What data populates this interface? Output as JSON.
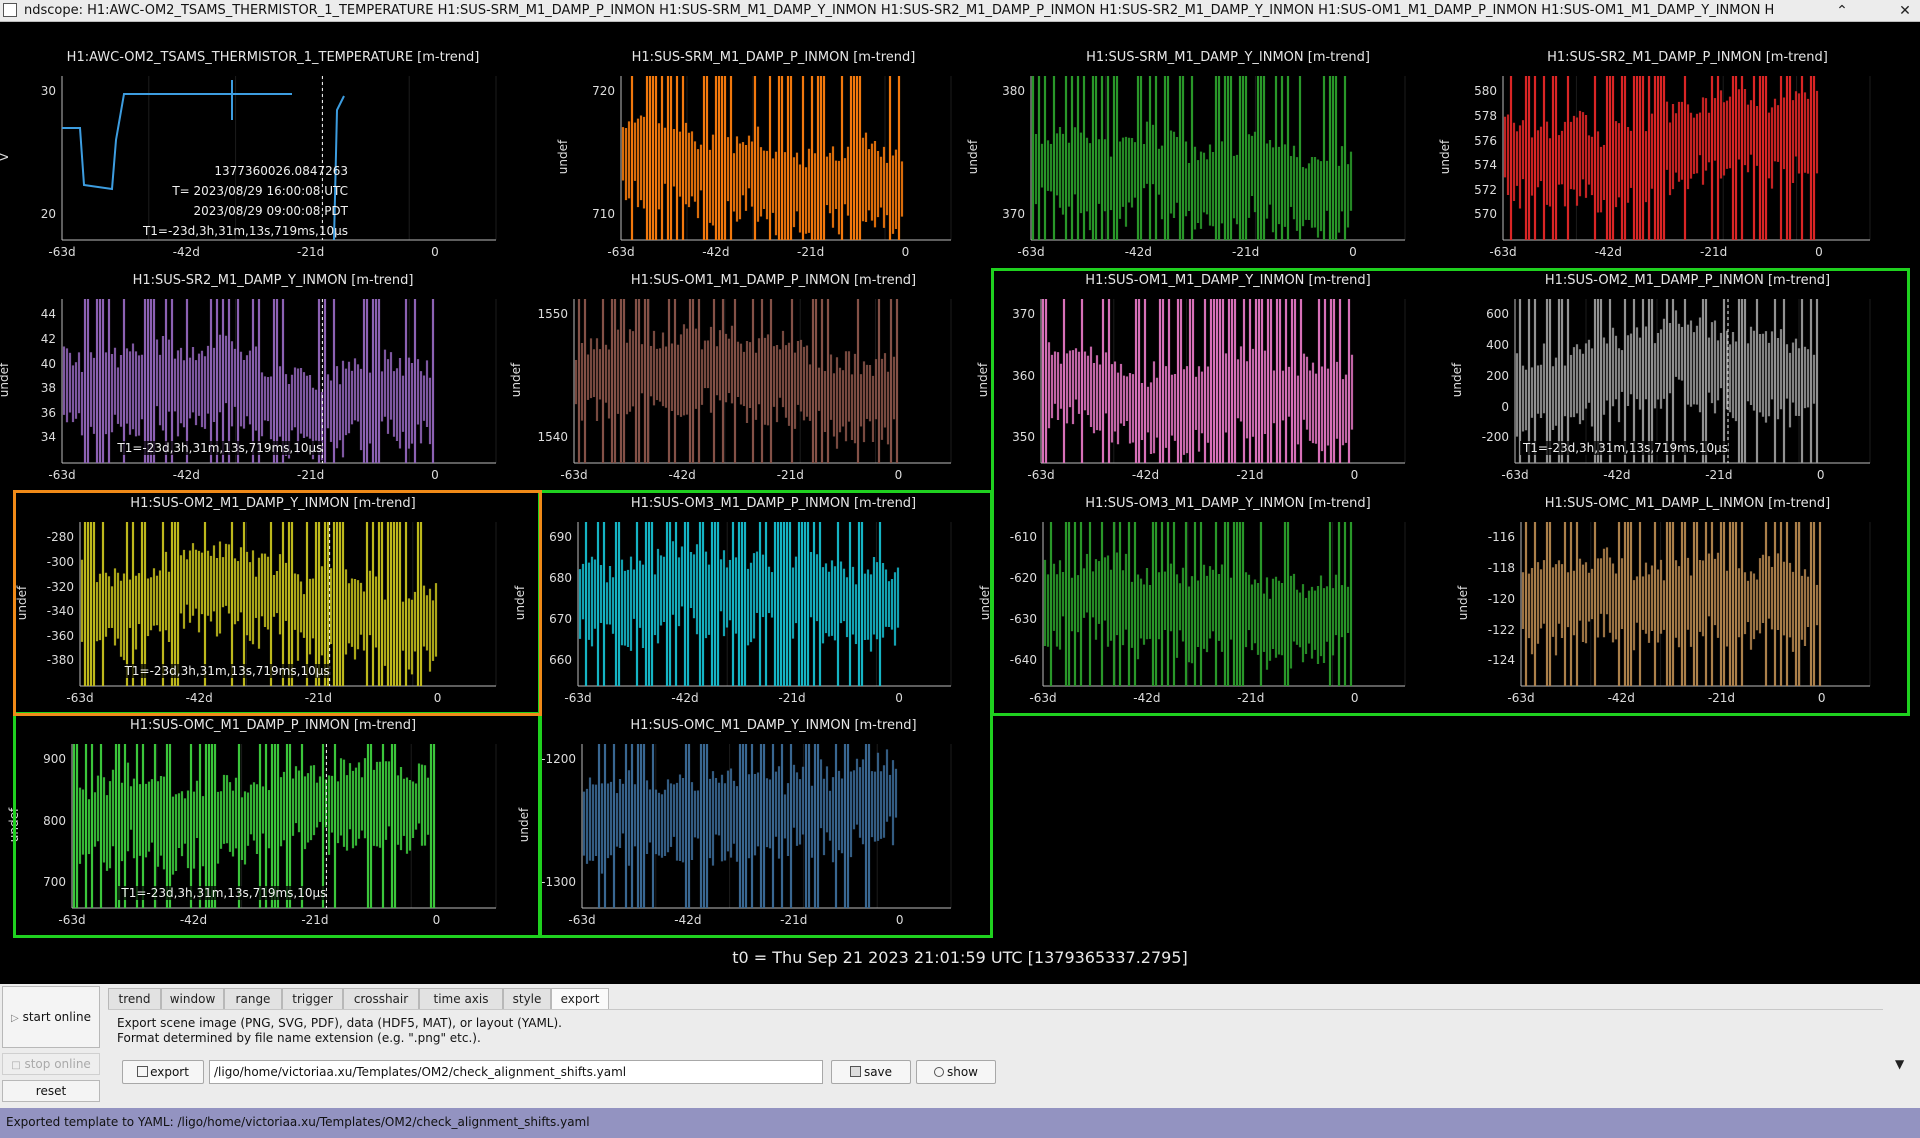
{
  "window": {
    "title": "ndscope: H1:AWC-OM2_TSAMS_THERMISTOR_1_TEMPERATURE H1:SUS-SRM_M1_DAMP_P_INMON H1:SUS-SRM_M1_DAMP_Y_INMON H1:SUS-SR2_M1_DAMP_P_INMON H1:SUS-SR2_M1_DAMP_Y_INMON H1:SUS-OM1_M1_DAMP_P_INMON H1:SUS-OM1_M1_DAMP_Y_INMON H",
    "minimize_icon": "chevron-up-icon",
    "close_icon": "close-icon",
    "minimize_glyph": "⌃",
    "close_glyph": "✕"
  },
  "t0_label": "t0 = Thu Sep 21 2023 21:01:59 UTC [1379365337.2795]",
  "x_ticks": [
    "-63d",
    "-42d",
    "-21d",
    "0"
  ],
  "crosshair": {
    "gps": "1377360026.0847263",
    "utc": "T= 2023/08/29 16:00:08 UTC",
    "pdt": "2023/08/29 09:00:08 PDT",
    "t1": "T1=-23d,3h,31m,13s,719ms,10µs"
  },
  "colors": {
    "selection_green": "#1fd11f",
    "selection_orange": "#f08a18",
    "background": "#000000"
  },
  "plots": [
    {
      "title": "H1:AWC-OM2_TSAMS_THERMISTOR_1_TEMPERATURE [m-trend]",
      "ylabel": "V",
      "yticks": [
        "20",
        "30"
      ],
      "color": "#3d9de0"
    },
    {
      "title": "H1:SUS-SRM_M1_DAMP_P_INMON [m-trend]",
      "ylabel": "undef",
      "yticks": [
        "710",
        "720"
      ],
      "color": "#ff7f0e"
    },
    {
      "title": "H1:SUS-SRM_M1_DAMP_Y_INMON [m-trend]",
      "ylabel": "undef",
      "yticks": [
        "370",
        "380"
      ],
      "color": "#2ca02c"
    },
    {
      "title": "H1:SUS-SR2_M1_DAMP_P_INMON [m-trend]",
      "ylabel": "undef",
      "yticks": [
        "570",
        "572",
        "574",
        "576",
        "578",
        "580"
      ],
      "color": "#e62828"
    },
    {
      "title": "H1:SUS-SR2_M1_DAMP_Y_INMON [m-trend]",
      "ylabel": "undef",
      "yticks": [
        "34",
        "36",
        "38",
        "40",
        "42",
        "44"
      ],
      "color": "#9467bd"
    },
    {
      "title": "H1:SUS-OM1_M1_DAMP_P_INMON [m-trend]",
      "ylabel": "undef",
      "yticks": [
        "1540",
        "1550"
      ],
      "color": "#8c564b"
    },
    {
      "title": "H1:SUS-OM1_M1_DAMP_Y_INMON [m-trend]",
      "ylabel": "undef",
      "yticks": [
        "350",
        "360",
        "370"
      ],
      "color": "#e377c2"
    },
    {
      "title": "H1:SUS-OM2_M1_DAMP_P_INMON [m-trend]",
      "ylabel": "undef",
      "yticks": [
        "-200",
        "0",
        "200",
        "400",
        "600"
      ],
      "color": "#9a9a9a"
    },
    {
      "title": "H1:SUS-OM2_M1_DAMP_Y_INMON [m-trend]",
      "ylabel": "undef",
      "yticks": [
        "-380",
        "-360",
        "-340",
        "-320",
        "-300",
        "-280"
      ],
      "color": "#c8c21e"
    },
    {
      "title": "H1:SUS-OM3_M1_DAMP_P_INMON [m-trend]",
      "ylabel": "undef",
      "yticks": [
        "660",
        "670",
        "680",
        "690"
      ],
      "color": "#17becf"
    },
    {
      "title": "H1:SUS-OM3_M1_DAMP_Y_INMON [m-trend]",
      "ylabel": "undef",
      "yticks": [
        "-640",
        "-630",
        "-620",
        "-610"
      ],
      "color": "#2ca02c"
    },
    {
      "title": "H1:SUS-OMC_M1_DAMP_L_INMON [m-trend]",
      "ylabel": "undef",
      "yticks": [
        "-124",
        "-122",
        "-120",
        "-118",
        "-116"
      ],
      "color": "#b5874f"
    },
    {
      "title": "H1:SUS-OMC_M1_DAMP_P_INMON [m-trend]",
      "ylabel": "undef",
      "yticks": [
        "700",
        "800",
        "900"
      ],
      "color": "#3fd13f"
    },
    {
      "title": "H1:SUS-OMC_M1_DAMP_Y_INMON [m-trend]",
      "ylabel": "undef",
      "yticks": [
        "-1300",
        "-1200"
      ],
      "color": "#3d6d99"
    }
  ],
  "controls": {
    "start_online": "start online",
    "stop_online": "stop online",
    "reset": "reset",
    "start_icon": "play-icon",
    "start_glyph": "▷",
    "stop_icon": "stop-icon",
    "stop_glyph": "□"
  },
  "tabs": [
    "trend",
    "window",
    "range",
    "trigger",
    "crosshair",
    "time axis",
    "style",
    "export"
  ],
  "active_tab": "export",
  "export": {
    "description_line1": "Export scene image (PNG, SVG, PDF), data (HDF5, MAT), or layout (YAML).",
    "description_line2": "Format determined by file name extension (e.g. \".png\" etc.).",
    "export_button": "export",
    "path_value": "/ligo/home/victoriaa.xu/Templates/OM2/check_alignment_shifts.yaml",
    "save_button": "save",
    "show_button": "show",
    "export_icon": "export-icon",
    "save_icon": "save-icon",
    "show_icon": "zoom-icon"
  },
  "collapse_icon": "triangle-down-icon",
  "collapse_glyph": "▼",
  "status": "Exported template to YAML: /ligo/home/victoriaa.xu/Templates/OM2/check_alignment_shifts.yaml"
}
